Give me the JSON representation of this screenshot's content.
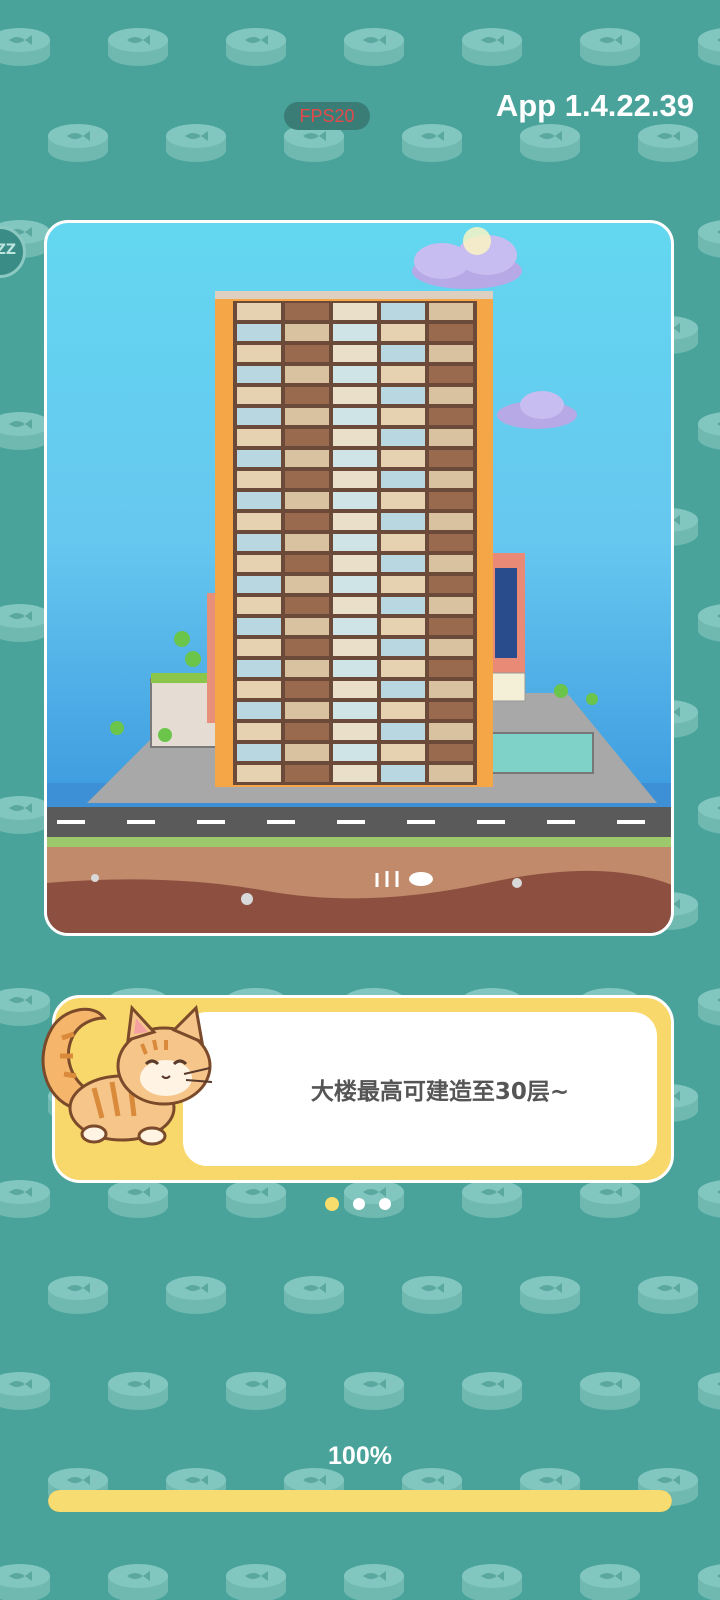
{
  "app": {
    "fps_label": "FPS20",
    "version_label": "App 1.4.22.39",
    "side_button_label": "ZZ"
  },
  "tip": {
    "text": "大楼最高可建造至30层~"
  },
  "carousel": {
    "page_count": 3,
    "active_index": 0
  },
  "loading": {
    "progress_label": "100%",
    "progress_fraction": 1.0
  },
  "colors": {
    "background": "#4aa39b",
    "accent_yellow": "#f7dc72",
    "fps_text": "#e44a4a"
  },
  "icons": [
    "fish-can-icon",
    "cat-mascot-icon",
    "sleep-zz-icon"
  ]
}
